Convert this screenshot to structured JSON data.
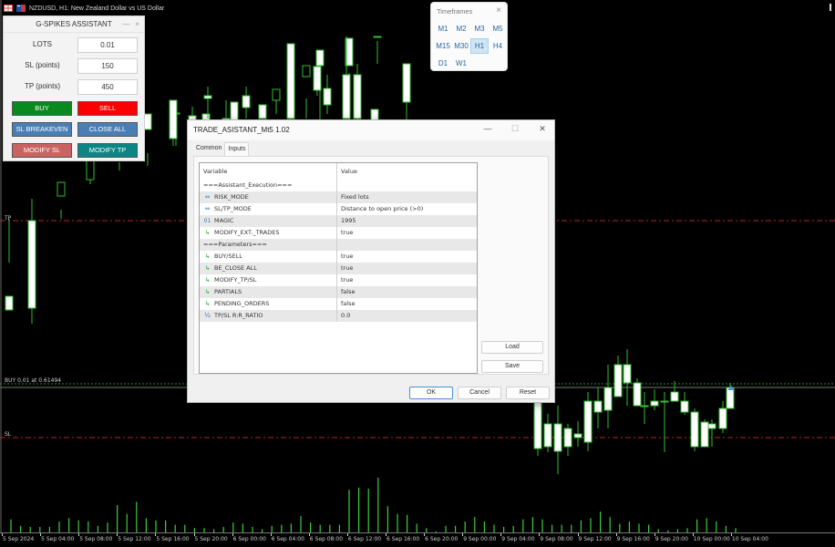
{
  "chart": {
    "symbol_title": "NZDUSD, H1:  New Zealand Dollar vs US Dollar",
    "tp_label": "TP",
    "sl_label": "SL",
    "position_label": "BUY 0.01 at 0.61494",
    "colors": {
      "background": "#000000",
      "candle": "#2fbf2f",
      "bull_body": "#000000",
      "bear_body": "#ffffff",
      "tp_sl_line": "#b32424",
      "position_line": "#2e8b2e",
      "volume": "#3ccf3c"
    },
    "time_labels": [
      "5 Sep 2024",
      "5 Sep 04:00",
      "5 Sep 08:00",
      "5 Sep 12:00",
      "5 Sep 16:00",
      "5 Sep 20:00",
      "6 Sep 00:00",
      "6 Sep 04:00",
      "6 Sep 08:00",
      "6 Sep 12:00",
      "6 Sep 16:00",
      "6 Sep 20:00",
      "9 Sep 00:00",
      "9 Sep 04:00",
      "9 Sep 08:00",
      "9 Sep 12:00",
      "9 Sep 16:00",
      "9 Sep 20:00",
      "10 Sep 00:00",
      "10 Sep 04:00"
    ]
  },
  "gspikes": {
    "title": "G-SPIKES ASSISTANT",
    "minimize_icon": "—",
    "close_icon": "×",
    "fields": [
      {
        "label": "LOTS",
        "value": "0.01"
      },
      {
        "label": "SL (points)",
        "value": "150"
      },
      {
        "label": "TP (points)",
        "value": "450"
      }
    ],
    "buttons": {
      "buy": "BUY",
      "sell": "SELL",
      "sl_breakeven": "SL BREAKEVEN",
      "close_all": "CLOSE ALL",
      "modify_sl": "MODIFY SL",
      "modify_tp": "MODIFY TP"
    }
  },
  "timeframes": {
    "title": "Timeframes",
    "close_icon": "×",
    "items": [
      "M1",
      "M2",
      "M3",
      "M5",
      "M15",
      "M30",
      "H1",
      "H4",
      "D1",
      "W1"
    ],
    "selected": "H1"
  },
  "dialog": {
    "title": "TRADE_ASISTANT_Mt5 1.02",
    "minimize_icon": "—",
    "maximize_icon": "☐",
    "close_icon": "✕",
    "tabs": [
      "Common",
      "Inputs"
    ],
    "active_tab": "Inputs",
    "columns": [
      "Variable",
      "Value"
    ],
    "rows": [
      {
        "icon": "",
        "variable": "===Assistant_Execution===",
        "value": ""
      },
      {
        "icon": "enum-icon",
        "variable": "RISK_MODE",
        "value": "Fixed lots"
      },
      {
        "icon": "enum-icon",
        "variable": "SL/TP_MODE",
        "value": "Distance to open price (>0)"
      },
      {
        "icon": "int-icon",
        "variable": "MAGIC",
        "value": "1995"
      },
      {
        "icon": "bool-icon",
        "variable": "MODIFY_EXT._TRADES",
        "value": "true"
      },
      {
        "icon": "",
        "variable": "===Parameters===",
        "value": ""
      },
      {
        "icon": "bool-icon",
        "variable": "BUY/SELL",
        "value": "true"
      },
      {
        "icon": "bool-icon",
        "variable": "BE_CLOSE ALL",
        "value": "true"
      },
      {
        "icon": "bool-icon",
        "variable": "MODIFY_TP/SL",
        "value": "true"
      },
      {
        "icon": "bool-icon",
        "variable": "PARTIALS",
        "value": "false"
      },
      {
        "icon": "bool-icon",
        "variable": "PENDING_ORDERS",
        "value": "false"
      },
      {
        "icon": "fraction-icon",
        "variable": "TP/SL R:R_RATIO",
        "value": "0.0"
      }
    ],
    "icon_glyphs": {
      "enum-icon": "⇔",
      "int-icon": "01",
      "bool-icon": "↳",
      "fraction-icon": "½"
    },
    "side_buttons": {
      "load": "Load",
      "save": "Save"
    },
    "footer_buttons": {
      "ok": "OK",
      "cancel": "Cancel",
      "reset": "Reset"
    }
  }
}
